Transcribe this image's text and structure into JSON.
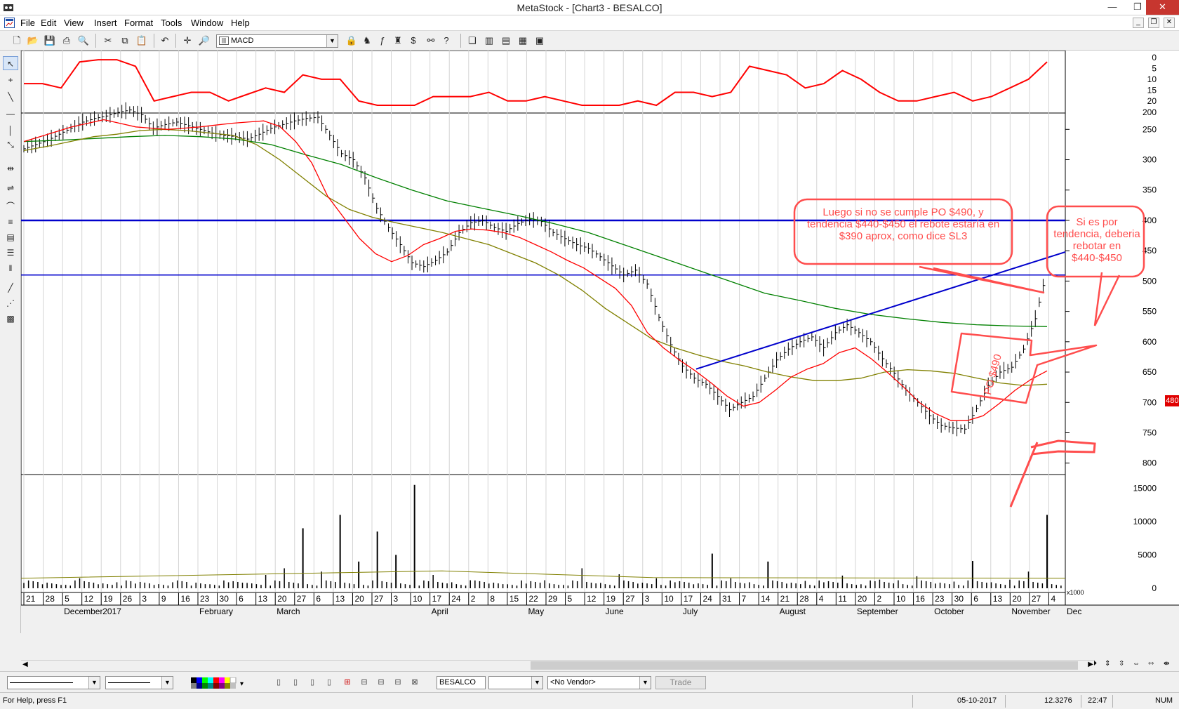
{
  "window": {
    "title": "MetaStock - [Chart3 - BESALCO]",
    "min": "—",
    "max": "❐",
    "close": "✕"
  },
  "menu": [
    "File",
    "Edit",
    "View",
    "Insert",
    "Format",
    "Tools",
    "Window",
    "Help"
  ],
  "toolbar": {
    "indicator": "MACD"
  },
  "annotations": {
    "left": "Luego si no se cumple PO $490, y tendencia $440-$450 el rebote estaría en $390 aprox, como dice SL3",
    "right": "Si es por tendencia, deberia rebotar en $440-$450",
    "po": "PO $490"
  },
  "last_price": "480.520",
  "bottom": {
    "security": "BESALCO",
    "vendor": "<No Vendor>",
    "trade": "Trade"
  },
  "status": {
    "help": "For Help, press F1",
    "date": "05-10-2017",
    "value": "12.3276",
    "time": "22:47",
    "num": "NUM"
  },
  "colors": {
    "price": "#000000",
    "ma_fast": "#ff0000",
    "ma_mid": "#808000",
    "ma_slow": "#008000",
    "hline": "#0000cc",
    "indicator": "#ff0000",
    "annotation": "#ff4d4d"
  },
  "chart_data": {
    "type": "ohlc",
    "security": "BESALCO",
    "x_ticks": [
      "21",
      "28",
      "5",
      "12",
      "19",
      "26",
      "3",
      "9",
      "16",
      "23",
      "30",
      "6",
      "13",
      "20",
      "27",
      "6",
      "13",
      "20",
      "27",
      "3",
      "10",
      "17",
      "24",
      "2",
      "8",
      "15",
      "22",
      "29",
      "5",
      "12",
      "19",
      "27",
      "3",
      "10",
      "17",
      "24",
      "31",
      "7",
      "14",
      "21",
      "28",
      "4",
      "11",
      "20",
      "2",
      "10",
      "16",
      "23",
      "30",
      "6",
      "13",
      "20",
      "27",
      "4"
    ],
    "months": [
      "December",
      "2017",
      "February",
      "March",
      "April",
      "May",
      "June",
      "July",
      "August",
      "September",
      "October",
      "November",
      "Dec"
    ],
    "price_axis": {
      "ticks": [
        250,
        300,
        350,
        400,
        450,
        500,
        550,
        600,
        650,
        700,
        750,
        800
      ],
      "scale": "reciprocal"
    },
    "volume_axis": {
      "ticks": [
        15000,
        10000,
        5000,
        0
      ],
      "unit": "x1000"
    },
    "indicator_axis": {
      "ticks": [
        0,
        5,
        10,
        15,
        20,
        200
      ]
    },
    "horizontal_lines": [
      400,
      490
    ],
    "price_path": [
      282,
      275,
      268,
      258,
      248,
      238,
      232,
      228,
      222,
      218,
      226,
      248,
      242,
      238,
      244,
      250,
      256,
      260,
      262,
      266,
      258,
      248,
      242,
      236,
      232,
      230,
      260,
      290,
      300,
      330,
      380,
      412,
      440,
      470,
      476,
      466,
      452,
      420,
      404,
      400,
      412,
      418,
      405,
      398,
      402,
      420,
      430,
      440,
      446,
      460,
      475,
      490,
      482,
      505,
      560,
      605,
      640,
      660,
      670,
      690,
      712,
      700,
      690,
      660,
      630,
      612,
      600,
      592,
      610,
      585,
      572,
      585,
      600,
      628,
      652,
      680,
      700,
      722,
      738,
      742,
      744,
      710,
      672,
      650,
      642,
      612,
      562,
      480
    ],
    "ma_fast": [
      270,
      262,
      254,
      246,
      240,
      234,
      240,
      246,
      248,
      250,
      248,
      246,
      243,
      240,
      238,
      236,
      245,
      270,
      305,
      360,
      395,
      430,
      455,
      468,
      458,
      440,
      430,
      418,
      414,
      416,
      420,
      428,
      440,
      452,
      466,
      478,
      495,
      512,
      540,
      585,
      610,
      630,
      648,
      668,
      690,
      706,
      700,
      680,
      658,
      645,
      636,
      618,
      610,
      628,
      650,
      674,
      700,
      718,
      730,
      730,
      722,
      702,
      680,
      662,
      648
    ],
    "ma_mid": [
      285,
      278,
      270,
      262,
      258,
      252,
      250,
      252,
      256,
      260,
      275,
      300,
      330,
      360,
      382,
      395,
      404,
      412,
      420,
      430,
      440,
      455,
      470,
      490,
      515,
      545,
      570,
      595,
      610,
      622,
      632,
      640,
      650,
      658,
      664,
      664,
      660,
      650,
      646,
      648,
      652,
      660,
      668,
      672,
      670
    ],
    "ma_slow": [
      270,
      268,
      265,
      262,
      260,
      262,
      266,
      275,
      292,
      308,
      330,
      350,
      368,
      380,
      392,
      405,
      420,
      440,
      460,
      480,
      500,
      520,
      532,
      545,
      555,
      562,
      568,
      572,
      574,
      575
    ],
    "volume": [
      800,
      600,
      500,
      1500,
      600,
      900,
      700,
      500,
      900,
      400,
      600,
      900,
      800,
      2000,
      3000,
      9000,
      2500,
      11000,
      4000,
      8500,
      5000,
      15500,
      2000,
      900,
      1200,
      700,
      600,
      700,
      1200,
      500,
      3000,
      800,
      2100,
      700,
      1500,
      900,
      600,
      5200,
      1500,
      900,
      4000,
      700,
      1100,
      900,
      1900,
      600,
      1300,
      1200,
      1800,
      700,
      1000,
      4100,
      900,
      1300,
      2500,
      11000
    ],
    "indicator_path": [
      12,
      12,
      14,
      2,
      1,
      1,
      4,
      20,
      18,
      16,
      16,
      20,
      17,
      14,
      16,
      8,
      10,
      10,
      20,
      22,
      22,
      22,
      18,
      18,
      18,
      16,
      20,
      20,
      18,
      20,
      22,
      22,
      22,
      20,
      22,
      16,
      16,
      18,
      16,
      4,
      6,
      8,
      14,
      12,
      6,
      10,
      16,
      20,
      20,
      18,
      16,
      20,
      18,
      14,
      10,
      2
    ]
  }
}
